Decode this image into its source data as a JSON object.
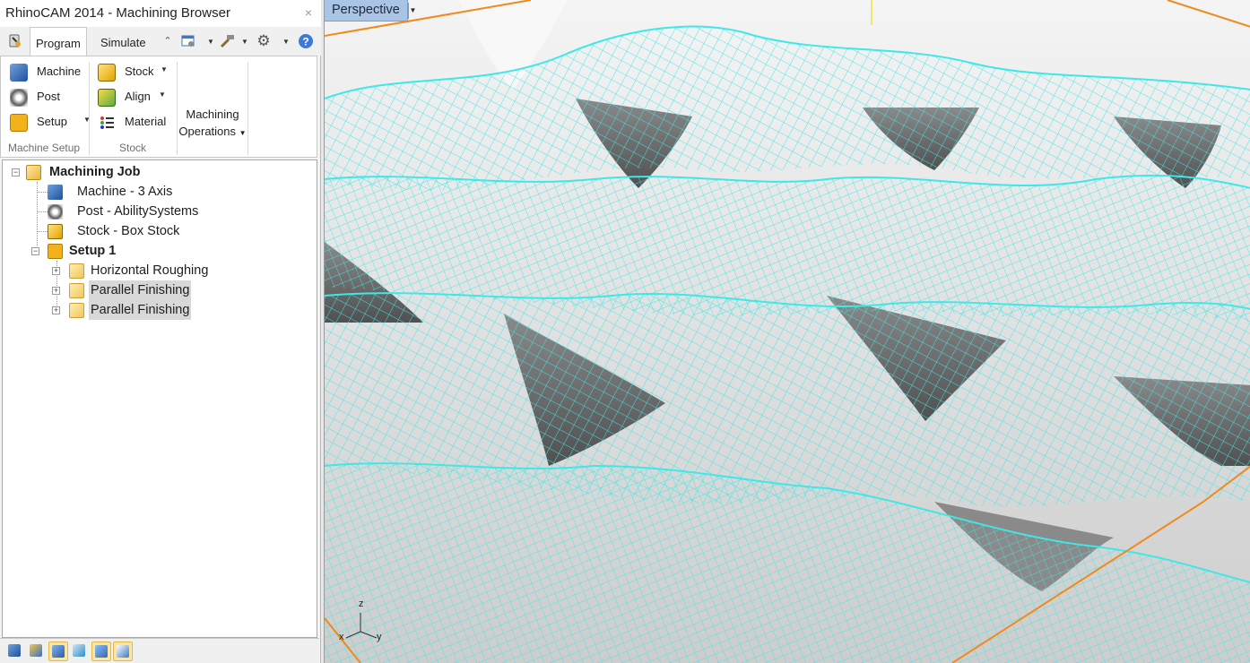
{
  "window": {
    "title": "RhinoCAM 2014 - Machining Browser",
    "close_glyph": "×"
  },
  "tabs": [
    {
      "label": "Program",
      "active": true
    },
    {
      "label": "Simulate",
      "active": false
    }
  ],
  "ribbon": {
    "machine_setup": {
      "machine_label": "Machine",
      "post_label": "Post",
      "setup_label": "Setup",
      "group_label": "Machine Setup"
    },
    "stock": {
      "stock_label": "Stock",
      "align_label": "Align",
      "material_label": "Material",
      "group_label": "Stock"
    },
    "machining_operations": {
      "line1": "Machining",
      "line2": "Operations"
    }
  },
  "tree": {
    "root": "Machining Job",
    "machine": "Machine - 3 Axis",
    "post": "Post - AbilitySystems",
    "stock": "Stock - Box Stock",
    "setup": "Setup 1",
    "operations": [
      {
        "label": "Horizontal Roughing",
        "highlighted": false
      },
      {
        "label": "Parallel Finishing",
        "highlighted": true
      },
      {
        "label": "Parallel Finishing",
        "highlighted": true
      }
    ]
  },
  "viewport": {
    "label": "Perspective",
    "axes": {
      "z": "z",
      "x": "x",
      "y": "y"
    },
    "colors": {
      "toolpath": "#3fe7e7",
      "surface": "#ececec",
      "shadow": "#6a6a6a",
      "grid_axis": "#f08a1c",
      "tab_bg": "#aac4e6"
    }
  }
}
